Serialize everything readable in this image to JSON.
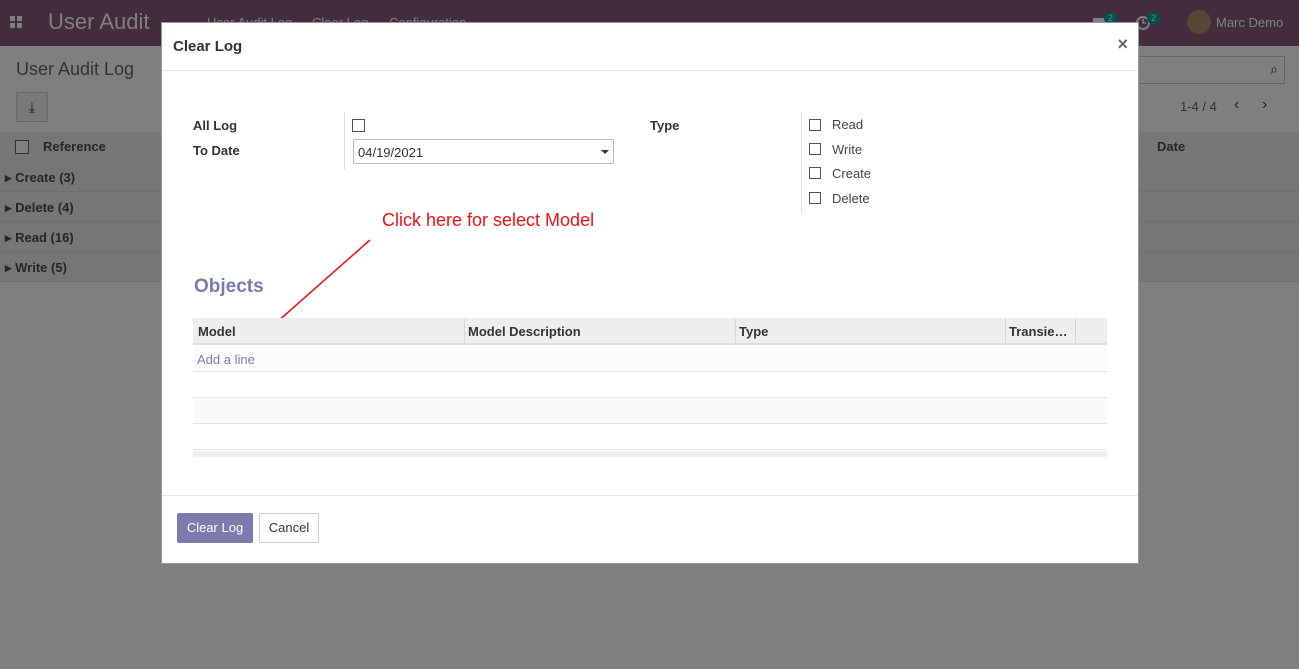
{
  "navbar": {
    "brand": "User Audit",
    "menu": [
      "User Audit Log",
      "Clear Log",
      "Configuration"
    ],
    "messages_count": "2",
    "activities_count": "2",
    "user_name": "Marc Demo"
  },
  "control_panel": {
    "breadcrumb": "User Audit Log",
    "pager": "1-4 / 4"
  },
  "list": {
    "columns": [
      "Reference",
      "Date"
    ],
    "groups": [
      {
        "label": "Create (3)"
      },
      {
        "label": "Delete (4)"
      },
      {
        "label": "Read (16)"
      },
      {
        "label": "Write (5)"
      }
    ]
  },
  "dialog": {
    "title": "Clear Log",
    "close_symbol": "×",
    "all_log_label": "All Log",
    "all_log_checked": false,
    "to_date_label": "To Date",
    "to_date_value": "04/19/2021",
    "type_label": "Type",
    "type_options": [
      {
        "label": "Read",
        "checked": false
      },
      {
        "label": "Write",
        "checked": false
      },
      {
        "label": "Create",
        "checked": false
      },
      {
        "label": "Delete",
        "checked": false
      }
    ],
    "annotation": "Click here for select Model",
    "objects_title": "Objects",
    "table_columns": [
      "Model",
      "Model Description",
      "Type",
      "Transie…"
    ],
    "add_line": "Add a line",
    "buttons": {
      "primary": "Clear Log",
      "cancel": "Cancel"
    }
  },
  "colors": {
    "navbar": "#875a7b",
    "primary": "#7c7bad",
    "annotation": "#ee1111"
  }
}
